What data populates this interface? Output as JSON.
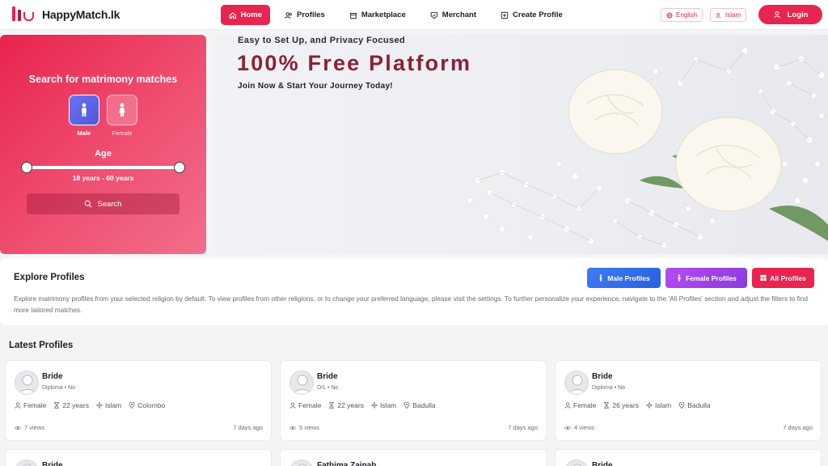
{
  "brand": {
    "name": "HappyMatch.lk",
    "accent": "#e8254f"
  },
  "nav": {
    "links": [
      {
        "label": "Home",
        "icon": "home-icon"
      },
      {
        "label": "Profiles",
        "icon": "users-icon"
      },
      {
        "label": "Marketplace",
        "icon": "store-icon"
      },
      {
        "label": "Merchant",
        "icon": "badge-icon"
      },
      {
        "label": "Create Profile",
        "icon": "plus-square-icon"
      }
    ],
    "language": "English",
    "religion": "Islam",
    "login": "Login"
  },
  "search": {
    "title": "Search for matrimony matches",
    "male_label": "Male",
    "female_label": "Female",
    "selected_gender": "Male",
    "age_label": "Age",
    "age_min": 18,
    "age_max": 60,
    "age_range_text": "18 years  -  60 years",
    "button": "Search"
  },
  "hero": {
    "subtitle": "Easy to Set Up, and Privacy Focused",
    "title": "100% Free Platform",
    "tagline": "Join Now & Start Your Journey Today!"
  },
  "explore": {
    "title": "Explore Profiles",
    "text": "Explore matrimony profiles from your selected religion by default. To view profiles from other religions, or to change your preferred language, please visit the settings. To further personalize your experience, navigate to the 'All Profiles' section and adjust the filters to find more tailored matches.",
    "buttons": {
      "male": "Male Profiles",
      "female": "Female Profiles",
      "all": "All Profiles"
    }
  },
  "latest": {
    "title": "Latest Profiles",
    "profiles": [
      {
        "name": "Bride",
        "education": "Diploma • No",
        "gender": "Female",
        "age": "22 years",
        "religion": "Islam",
        "location": "Colombo",
        "views": "7 views",
        "posted": "7 days ago"
      },
      {
        "name": "Bride",
        "education": "O/L • No",
        "gender": "Female",
        "age": "22 years",
        "religion": "Islam",
        "location": "Badulla",
        "views": "5 views",
        "posted": "7 days ago"
      },
      {
        "name": "Bride",
        "education": "Diploma • No",
        "gender": "Female",
        "age": "26 years",
        "religion": "Islam",
        "location": "Badulla",
        "views": "4 views",
        "posted": "7 days ago"
      }
    ],
    "next_row": [
      {
        "name": "Bride"
      },
      {
        "name": "Fathima Zainab"
      },
      {
        "name": "Bride"
      }
    ]
  }
}
